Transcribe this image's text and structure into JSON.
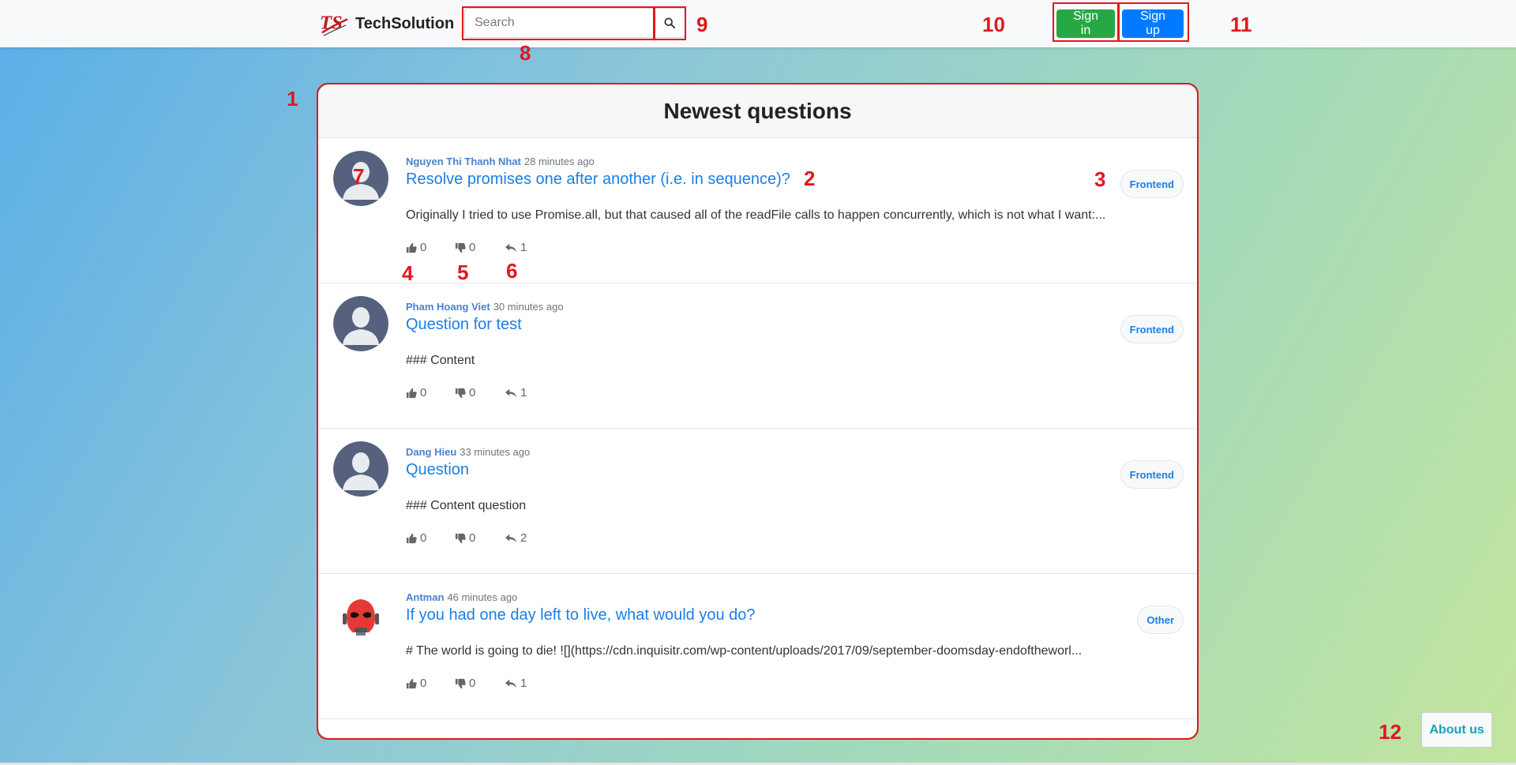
{
  "navbar": {
    "brand_name": "TechSolution",
    "logo_icon": "ts-logo-icon",
    "search_placeholder": "Search",
    "search_icon": "search-icon",
    "signin_label": "Sign in",
    "signup_label": "Sign up"
  },
  "main": {
    "title": "Newest questions",
    "questions": [
      {
        "author": "Nguyen Thi Thanh Nhat",
        "time": "28 minutes ago",
        "title": "Resolve promises one after another (i.e. in sequence)?",
        "excerpt": "Originally I tried to use Promise.all, but that caused all of the readFile calls to happen concurrently, which is not what I want:...",
        "likes": "0",
        "dislikes": "0",
        "replies": "1",
        "tag": "Frontend",
        "avatar": "default-avatar"
      },
      {
        "author": "Pham Hoang Viet",
        "time": "30 minutes ago",
        "title": "Question for test",
        "excerpt": "### Content",
        "likes": "0",
        "dislikes": "0",
        "replies": "1",
        "tag": "Frontend",
        "avatar": "default-avatar"
      },
      {
        "author": "Dang Hieu",
        "time": "33 minutes ago",
        "title": "Question",
        "excerpt": "### Content question",
        "likes": "0",
        "dislikes": "0",
        "replies": "2",
        "tag": "Frontend",
        "avatar": "default-avatar"
      },
      {
        "author": "Antman",
        "time": "46 minutes ago",
        "title": "If you had one day left to live, what would you do?",
        "excerpt": "# The world is going to die! ![](https://cdn.inquisitr.com/wp-content/uploads/2017/09/september-doomsday-endoftheworl...",
        "likes": "0",
        "dislikes": "0",
        "replies": "1",
        "tag": "Other",
        "avatar": "antman-avatar"
      }
    ]
  },
  "footer": {
    "about_label": "About us"
  },
  "annotations": [
    "1",
    "2",
    "3",
    "4",
    "5",
    "6",
    "7",
    "8",
    "9",
    "10",
    "11",
    "12"
  ],
  "colors": {
    "annotation": "#e3171e",
    "link": "#1a7fe6",
    "signin": "#28a745",
    "signup": "#007bff",
    "about": "#17a2b8"
  }
}
